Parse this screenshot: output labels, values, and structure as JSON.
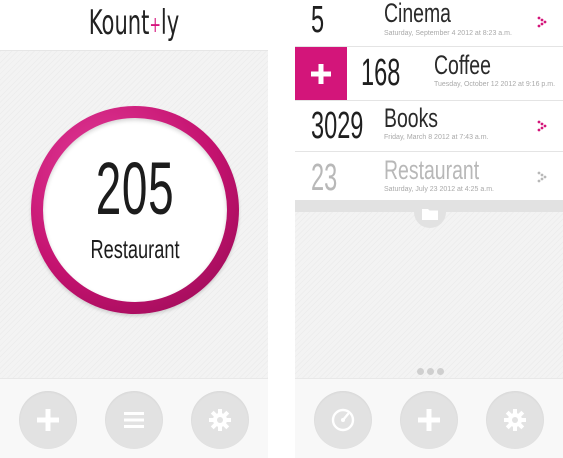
{
  "left_screen": {
    "logo": {
      "text_before": "Kount",
      "plus": "+",
      "text_after": "ly"
    },
    "counter": {
      "value": "205",
      "label": "Restaurant"
    },
    "toolbar": {
      "buttons": [
        "add-icon",
        "menu-icon",
        "gear-icon"
      ]
    }
  },
  "right_screen": {
    "counters": [
      {
        "count": "5",
        "name": "Cinema",
        "date": "Saturday, September 4 2012 at 8:23 a.m."
      },
      {
        "count": "168",
        "name": "Coffee",
        "date": "Tuesday, October 12 2012 at 9:16 p.m."
      },
      {
        "count": "3029",
        "name": "Books",
        "date": "Friday, March 8 2012 at 7:43 a.m."
      },
      {
        "count": "23",
        "name": "Restaurant",
        "date": "Saturday, July 23 2012 at 4:25 a.m."
      }
    ],
    "toolbar": {
      "buttons": [
        "dashboard-icon",
        "add-icon",
        "gear-icon"
      ]
    }
  },
  "colors": {
    "accent": "#d3157a",
    "ring_dark": "#8e0a50",
    "background": "#f3f3f3"
  }
}
